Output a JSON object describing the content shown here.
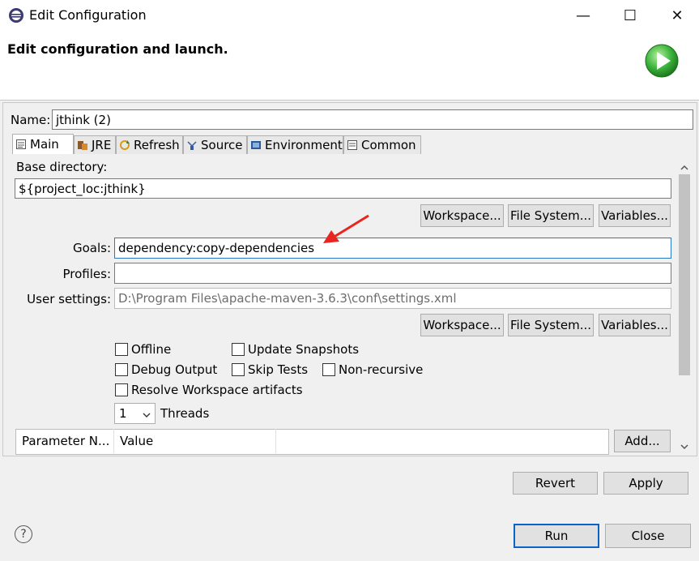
{
  "window": {
    "title": "Edit Configuration",
    "controls": {
      "minimize": "—",
      "maximize": "☐",
      "close": "✕"
    }
  },
  "header": {
    "title": "Edit configuration and launch."
  },
  "name_field": {
    "label": "Name:",
    "value": "jthink (2)"
  },
  "tabs": [
    {
      "label": "Main",
      "icon": "main-tab-icon",
      "active": true
    },
    {
      "label": "JRE",
      "icon": "jre-icon",
      "active": false
    },
    {
      "label": "Refresh",
      "icon": "refresh-icon",
      "active": false
    },
    {
      "label": "Source",
      "icon": "source-icon",
      "active": false
    },
    {
      "label": "Environment",
      "icon": "environment-icon",
      "active": false
    },
    {
      "label": "Common",
      "icon": "common-icon",
      "active": false
    }
  ],
  "base_directory": {
    "label": "Base directory:",
    "value": "${project_loc:jthink}",
    "buttons": [
      "Workspace...",
      "File System...",
      "Variables..."
    ]
  },
  "goals": {
    "label": "Goals:",
    "value": "dependency:copy-dependencies"
  },
  "profiles": {
    "label": "Profiles:",
    "value": ""
  },
  "user_settings": {
    "label": "User settings:",
    "value": "D:\\Program Files\\apache-maven-3.6.3\\conf\\settings.xml",
    "buttons": [
      "Workspace...",
      "File System...",
      "Variables..."
    ]
  },
  "options": {
    "offline": "Offline",
    "update_snapshots": "Update Snapshots",
    "debug_output": "Debug Output",
    "skip_tests": "Skip Tests",
    "non_recursive": "Non-recursive",
    "resolve_workspace": "Resolve Workspace artifacts"
  },
  "threads": {
    "value": "1",
    "label": "Threads"
  },
  "parameters_table": {
    "columns": [
      "Parameter N...",
      "Value"
    ],
    "add_button": "Add..."
  },
  "footer": {
    "revert": "Revert",
    "apply": "Apply",
    "run": "Run",
    "close": "Close",
    "help": "?"
  },
  "colors": {
    "accent": "#0a64c8",
    "arrow": "#e8251e",
    "run_icon": "#3cb43c"
  }
}
